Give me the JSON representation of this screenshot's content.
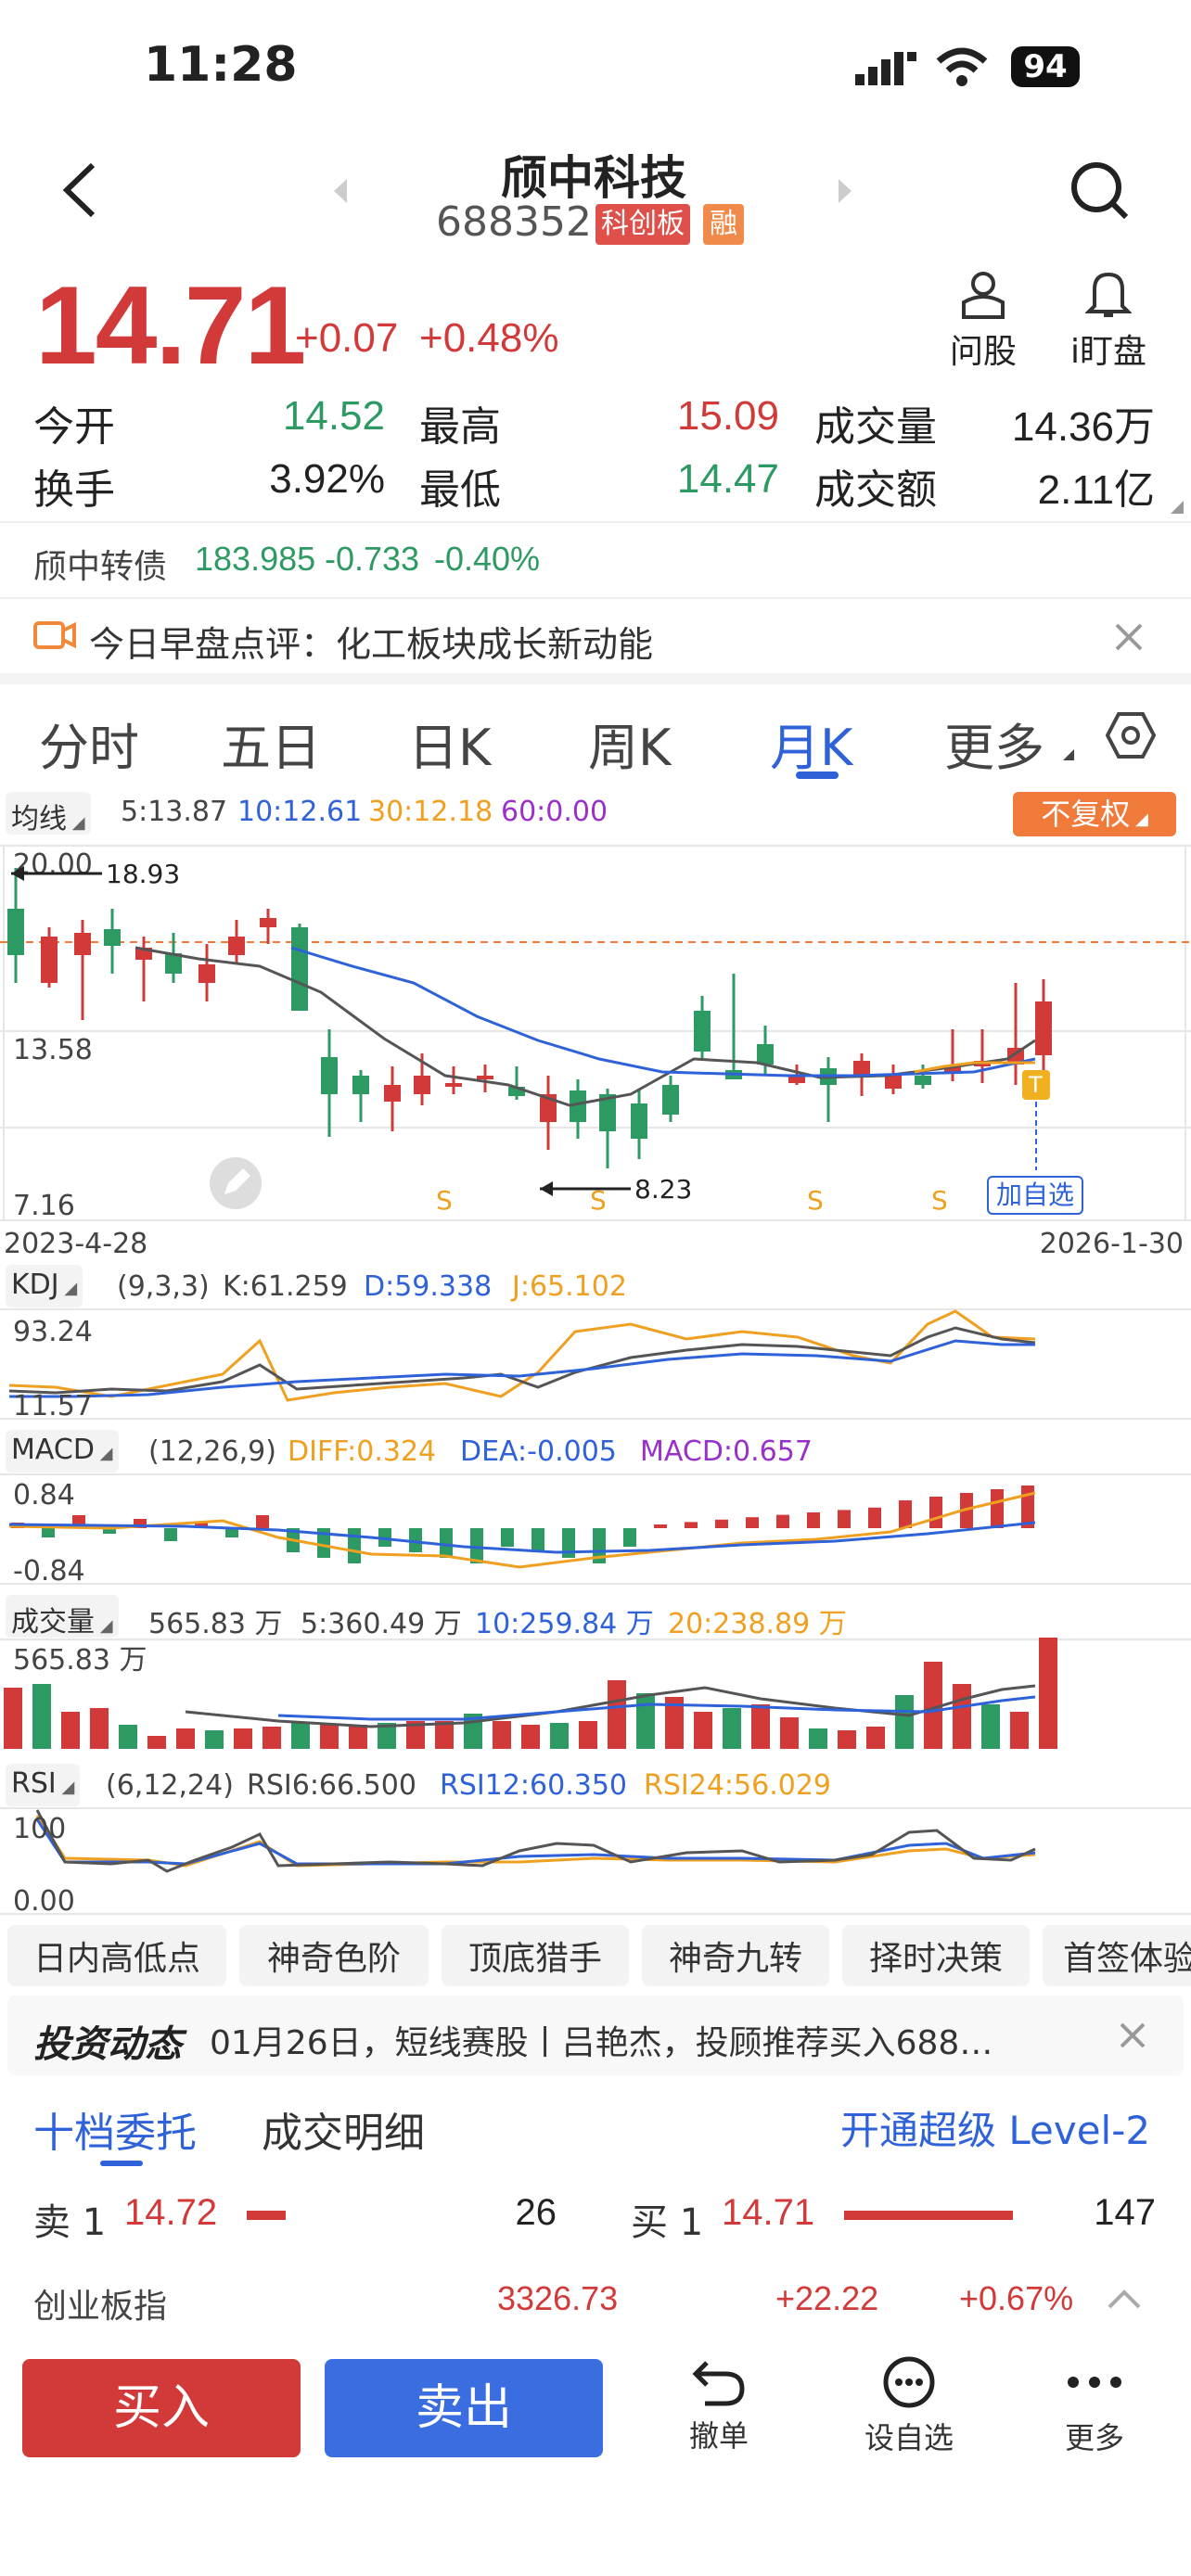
{
  "status_bar": {
    "time": "11:28",
    "battery": "94"
  },
  "header": {
    "title": "颀中科技",
    "code": "688352",
    "badge_board": "科创板",
    "badge_margin": "融"
  },
  "quote": {
    "price": "14.71",
    "change": "+0.07",
    "change_pct": "+0.48%",
    "ask_label": "问股",
    "watch_label": "i盯盘",
    "open_label": "今开",
    "open": "14.52",
    "high_label": "最高",
    "high": "15.09",
    "volume_label": "成交量",
    "volume": "14.36万",
    "turnover_label": "换手",
    "turnover": "3.92%",
    "low_label": "最低",
    "low": "14.47",
    "amount_label": "成交额",
    "amount": "2.11亿"
  },
  "bond": {
    "name": "颀中转债",
    "price": "183.985",
    "change": "-0.733",
    "change_pct": "-0.40%"
  },
  "news_banner": {
    "text": "今日早盘点评：化工板块成长新动能"
  },
  "chart_tabs": [
    "分时",
    "五日",
    "日K",
    "周K",
    "月K",
    "更多"
  ],
  "active_tab": 4,
  "ma_bar": {
    "label": "均线",
    "ma5": "5:13.87",
    "ma10": "10:12.61",
    "ma30": "30:12.18",
    "ma60": "60:0.00",
    "adjust": "不复权"
  },
  "kline": {
    "y_top": "20.00",
    "y_mid": "13.58",
    "y_bottom": "7.16",
    "max_mark": "18.93",
    "min_mark": "8.23",
    "start_date": "2023-4-28",
    "end_date": "2026-1-30",
    "t_marker": "T",
    "add_watch": "加自选",
    "s_marker": "S"
  },
  "kdj": {
    "label": "KDJ",
    "params": "(9,3,3)",
    "k": "K:61.259",
    "d": "D:59.338",
    "j": "J:65.102",
    "y_top": "93.24",
    "y_bottom": "11.57"
  },
  "macd": {
    "label": "MACD",
    "params": "(12,26,9)",
    "diff": "DIFF:0.324",
    "dea": "DEA:-0.005",
    "macd": "MACD:0.657",
    "y_top": "0.84",
    "y_bottom": "-0.84"
  },
  "vol": {
    "label": "成交量",
    "v": "565.83 万",
    "ma5": "5:360.49 万",
    "ma10": "10:259.84 万",
    "ma20": "20:238.89 万",
    "y_top": "565.83 万"
  },
  "rsi": {
    "label": "RSI",
    "params": "(6,12,24)",
    "rsi6": "RSI6:66.500",
    "rsi12": "RSI12:60.350",
    "rsi24": "RSI24:56.029",
    "y_top": "100",
    "y_bottom": "0.00"
  },
  "tools": [
    "日内高低点",
    "神奇色阶",
    "顶底猎手",
    "神奇九转",
    "择时决策",
    "首签体验"
  ],
  "news": {
    "label": "投资动态",
    "text": "01月26日，短线赛股丨吕艳杰，投顾推荐买入688…"
  },
  "order_tabs": {
    "depth": "十档委托",
    "trades": "成交明细",
    "level2": "开通超级 Level-2"
  },
  "order_book": {
    "ask_label": "卖 1",
    "ask_price": "14.72",
    "ask_vol": "26",
    "bid_label": "买 1",
    "bid_price": "14.71",
    "bid_vol": "147"
  },
  "index_bar": {
    "name": "创业板指",
    "value": "3326.73",
    "change": "+22.22",
    "change_pct": "+0.67%"
  },
  "bottom": {
    "buy": "买入",
    "sell": "卖出",
    "cancel": "撤单",
    "watch": "设自选",
    "more": "更多"
  },
  "colors": {
    "up": "#d23a3a",
    "down": "#2e9a63",
    "blue": "#2f62d8",
    "orange": "#f0a020",
    "purple": "#9b2fc9",
    "buy_btn": "#d23a3a",
    "sell_btn": "#3a6ee0"
  }
}
